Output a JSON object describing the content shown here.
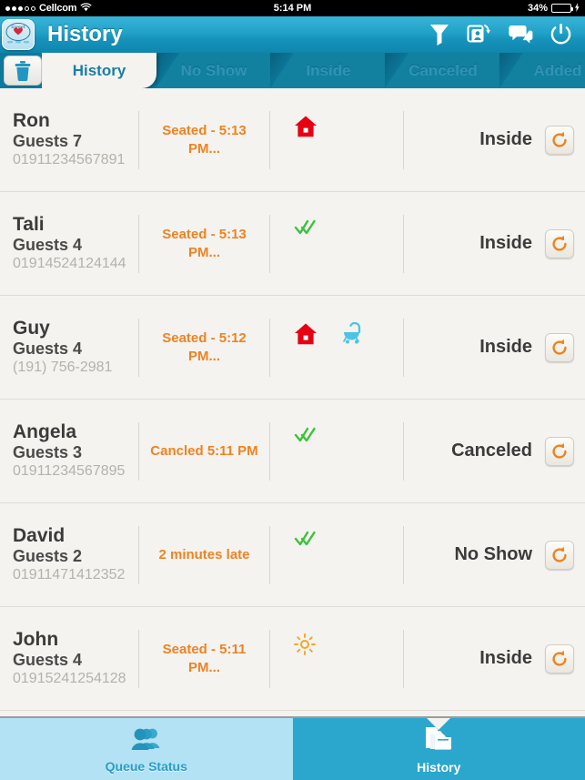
{
  "status_bar": {
    "carrier": "Cellcom",
    "signal_filled": 3,
    "signal_empty": 2,
    "wifi_icon": "wifi-icon",
    "time": "5:14 PM",
    "battery_percent": "34%",
    "battery_level": 34,
    "battery_color": "#4cd964",
    "charging": true
  },
  "nav": {
    "logo_icon": "app-logo-icon",
    "title": "History",
    "actions": [
      {
        "icon": "filter-icon",
        "name": "filter-button"
      },
      {
        "icon": "contact-transfer-icon",
        "name": "assign-contact-button"
      },
      {
        "icon": "chat-icon",
        "name": "messages-button"
      },
      {
        "icon": "power-icon",
        "name": "power-button"
      }
    ]
  },
  "tabstrip": {
    "trash_icon": "trash-icon",
    "tabs": [
      {
        "label": "History",
        "active": true
      },
      {
        "label": "No Show",
        "active": false
      },
      {
        "label": "Inside",
        "active": false
      },
      {
        "label": "Canceled",
        "active": false
      },
      {
        "label": "Added",
        "active": false
      }
    ]
  },
  "colors": {
    "accent_teal": "#22a2c8",
    "tab_bar_teal": "#0c7a9e",
    "orange": "#f08222",
    "list_bg": "#f4f3ef",
    "house_red": "#e60012",
    "check_green": "#3ec13e",
    "stroller_blue": "#4ec3e8",
    "sun_orange": "#f5a623"
  },
  "list": {
    "rows": [
      {
        "name": "Ron",
        "guests": "Guests 7",
        "phone": "01911234567891",
        "time": "Seated - 5:13 PM...",
        "icons": [
          "house-icon"
        ],
        "status": "Inside",
        "refresh_icon": "refresh-icon"
      },
      {
        "name": "Tali",
        "guests": "Guests 4",
        "phone": "01914524124144",
        "time": "Seated - 5:13 PM...",
        "icons": [
          "double-check-icon"
        ],
        "status": "Inside",
        "refresh_icon": "refresh-icon"
      },
      {
        "name": "Guy",
        "guests": "Guests 4",
        "phone": "(191) 756-2981",
        "time": "Seated - 5:12 PM...",
        "icons": [
          "house-icon",
          "stroller-icon"
        ],
        "status": "Inside",
        "refresh_icon": "refresh-icon"
      },
      {
        "name": "Angela",
        "guests": "Guests 3",
        "phone": "01911234567895",
        "time": "Cancled 5:11 PM",
        "icons": [
          "double-check-icon"
        ],
        "status": "Canceled",
        "refresh_icon": "refresh-icon"
      },
      {
        "name": "David",
        "guests": "Guests 2",
        "phone": "01911471412352",
        "time": "2 minutes late",
        "icons": [
          "double-check-icon"
        ],
        "status": "No Show",
        "refresh_icon": "refresh-icon"
      },
      {
        "name": "John",
        "guests": "Guests 4",
        "phone": "01915241254128",
        "time": "Seated - 5:11 PM...",
        "icons": [
          "sun-icon"
        ],
        "status": "Inside",
        "refresh_icon": "refresh-icon"
      }
    ]
  },
  "bottom_bar": {
    "items": [
      {
        "label": "Queue Status",
        "icon": "people-icon",
        "active": false
      },
      {
        "label": "History",
        "icon": "folder-icon",
        "active": true
      }
    ]
  }
}
